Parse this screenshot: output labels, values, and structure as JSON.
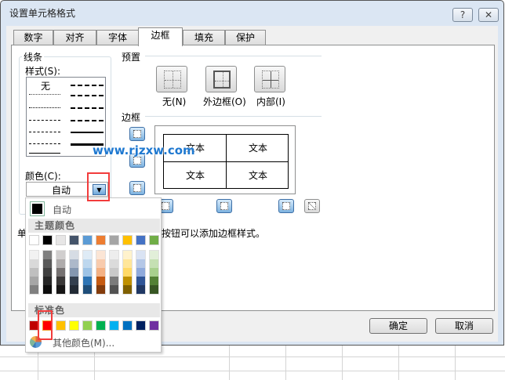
{
  "window": {
    "title": "设置单元格格式",
    "help_icon": "?",
    "close_icon": "✕"
  },
  "tabs": [
    {
      "label": "数字"
    },
    {
      "label": "对齐"
    },
    {
      "label": "字体"
    },
    {
      "label": "边框",
      "active": true
    },
    {
      "label": "填充"
    },
    {
      "label": "保护"
    }
  ],
  "line": {
    "group_label": "线条",
    "style_label": "样式(S):",
    "none_label": "无",
    "color_label": "颜色(C):",
    "color_value": "自动"
  },
  "presets": {
    "label": "预置",
    "items": [
      {
        "label": "无(N)"
      },
      {
        "label": "外边框(O)"
      },
      {
        "label": "内部(I)"
      }
    ]
  },
  "border": {
    "label": "边框",
    "preview_text": [
      "文本",
      "文本",
      "文本",
      "文本"
    ]
  },
  "hint": {
    "visible_start": "单",
    "visible_end": "按钮可以添加边框样式。"
  },
  "color_popup": {
    "auto_label": "自动",
    "theme_label": "主题颜色",
    "theme_colors": [
      "#ffffff",
      "#000000",
      "#e7e6e6",
      "#44546a",
      "#5b9bd5",
      "#ed7d31",
      "#a5a5a5",
      "#ffc000",
      "#4472c4",
      "#70ad47"
    ],
    "theme_shades": [
      [
        "#f2f2f2",
        "#d9d9d9",
        "#bfbfbf",
        "#a6a6a6",
        "#808080"
      ],
      [
        "#808080",
        "#595959",
        "#404040",
        "#262626",
        "#0d0d0d"
      ],
      [
        "#d0cece",
        "#aeabab",
        "#757171",
        "#3a3838",
        "#171616"
      ],
      [
        "#d6dce4",
        "#adb9ca",
        "#8497b0",
        "#333f4f",
        "#222a35"
      ],
      [
        "#deebf6",
        "#bdd7ee",
        "#9dc3e6",
        "#2e75b5",
        "#1f4e79"
      ],
      [
        "#fbe5d5",
        "#f8cbad",
        "#f4b183",
        "#c55a11",
        "#843c0c"
      ],
      [
        "#ededed",
        "#dbdbdb",
        "#c9c9c9",
        "#7b7b7b",
        "#525252"
      ],
      [
        "#fff2cc",
        "#ffe699",
        "#ffd966",
        "#bf9000",
        "#7f6000"
      ],
      [
        "#dae3f3",
        "#b4c7e7",
        "#8faadc",
        "#2f5597",
        "#203864"
      ],
      [
        "#e2efd9",
        "#c5e0b3",
        "#a8d08d",
        "#538135",
        "#375623"
      ]
    ],
    "standard_label": "标准色",
    "standard_colors": [
      "#c00000",
      "#ff0000",
      "#ffc000",
      "#ffff00",
      "#92d050",
      "#00b050",
      "#00b0f0",
      "#0070c0",
      "#002060",
      "#7030a0"
    ],
    "selected_standard": 1,
    "more_colors_label": "其他颜色(M)..."
  },
  "buttons": {
    "ok": "确定",
    "cancel": "取消"
  },
  "watermark": "www.rjzxw.com",
  "accent": "#f23c3c"
}
